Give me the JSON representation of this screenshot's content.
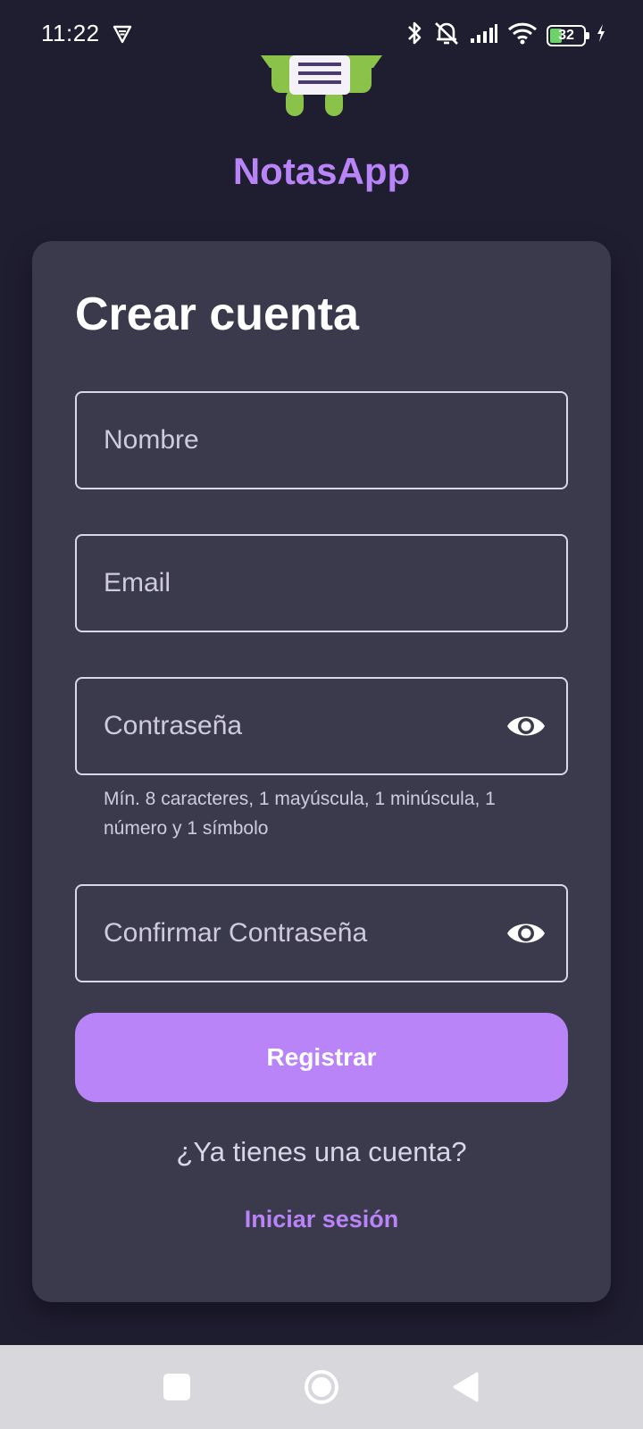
{
  "status_bar": {
    "time": "11:22",
    "battery_level": "32",
    "icons": [
      "vpn-shield-icon",
      "bluetooth-icon",
      "mute-bell-icon",
      "signal-icon",
      "wifi-icon",
      "battery-icon",
      "charging-icon"
    ]
  },
  "app": {
    "name": "NotasApp",
    "accent_color": "#b884f7",
    "background_color": "#1f1d30",
    "card_color": "#3b3a4c"
  },
  "form": {
    "title": "Crear cuenta",
    "name_placeholder": "Nombre",
    "email_placeholder": "Email",
    "password_placeholder": "Contraseña",
    "password_hint": "Mín. 8 caracteres, 1 mayúscula, 1 minúscula, 1 número y 1 símbolo",
    "confirm_password_placeholder": "Confirmar Contraseña",
    "submit_label": "Registrar",
    "have_account_text": "¿Ya tienes una cuenta?",
    "login_link": "Iniciar sesión"
  },
  "nav_bar": {
    "icons": [
      "recents-square-icon",
      "home-circle-icon",
      "back-triangle-icon"
    ]
  }
}
